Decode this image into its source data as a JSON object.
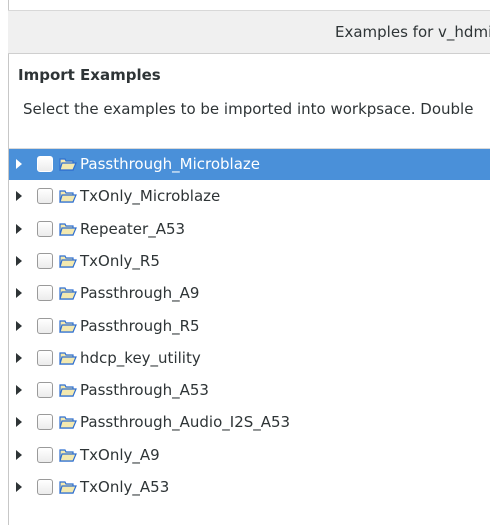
{
  "dialog": {
    "title": "Examples for v_hdmi"
  },
  "header": {
    "heading": "Import Examples",
    "description": "Select the examples to be imported into workpsace. Double"
  },
  "tree": {
    "items": [
      {
        "label": "Passthrough_Microblaze",
        "checked": false,
        "selected": true
      },
      {
        "label": "TxOnly_Microblaze",
        "checked": false,
        "selected": false
      },
      {
        "label": "Repeater_A53",
        "checked": false,
        "selected": false
      },
      {
        "label": "TxOnly_R5",
        "checked": false,
        "selected": false
      },
      {
        "label": "Passthrough_A9",
        "checked": false,
        "selected": false
      },
      {
        "label": "Passthrough_R5",
        "checked": false,
        "selected": false
      },
      {
        "label": "hdcp_key_utility",
        "checked": false,
        "selected": false
      },
      {
        "label": "Passthrough_A53",
        "checked": false,
        "selected": false
      },
      {
        "label": "Passthrough_Audio_I2S_A53",
        "checked": false,
        "selected": false
      },
      {
        "label": "TxOnly_A9",
        "checked": false,
        "selected": false
      },
      {
        "label": "TxOnly_A53",
        "checked": false,
        "selected": false
      }
    ]
  },
  "colors": {
    "selection": "#4a90d9",
    "folder_fill": "#f3e9b0",
    "folder_stroke": "#2f6fd0",
    "text": "#2e3436"
  },
  "icons": {
    "expander": "triangle-right-icon",
    "checkbox": "checkbox-unchecked-icon",
    "folder": "open-folder-icon"
  }
}
